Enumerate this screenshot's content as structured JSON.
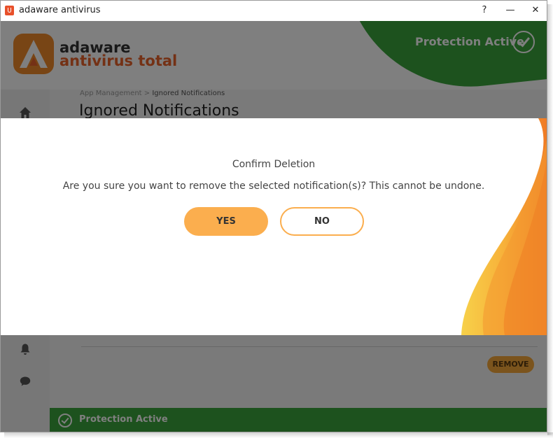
{
  "window": {
    "title": "adaware antivirus",
    "help_label": "?",
    "minimize_label": "—",
    "close_label": "✕"
  },
  "header": {
    "brand_line1": "adaware",
    "brand_line2": "antivirus total",
    "protection_status": "Protection Active"
  },
  "page": {
    "breadcrumb_parent": "App Management",
    "breadcrumb_separator": " > ",
    "breadcrumb_current": "Ignored Notifications",
    "title": "Ignored Notifications",
    "remove_label": "REMOVE"
  },
  "footer": {
    "status_text": "Protection Active"
  },
  "dialog": {
    "title": "Confirm Deletion",
    "message": "Are you sure you want to remove the selected notification(s)? This cannot be undone.",
    "yes_label": "YES",
    "no_label": "NO"
  },
  "colors": {
    "accent_orange": "#fbae4e",
    "brand_orange": "#e9632a",
    "status_green": "#3aa43c"
  },
  "icons": [
    "home-icon",
    "bell-icon",
    "chat-icon",
    "check-circle-icon"
  ]
}
